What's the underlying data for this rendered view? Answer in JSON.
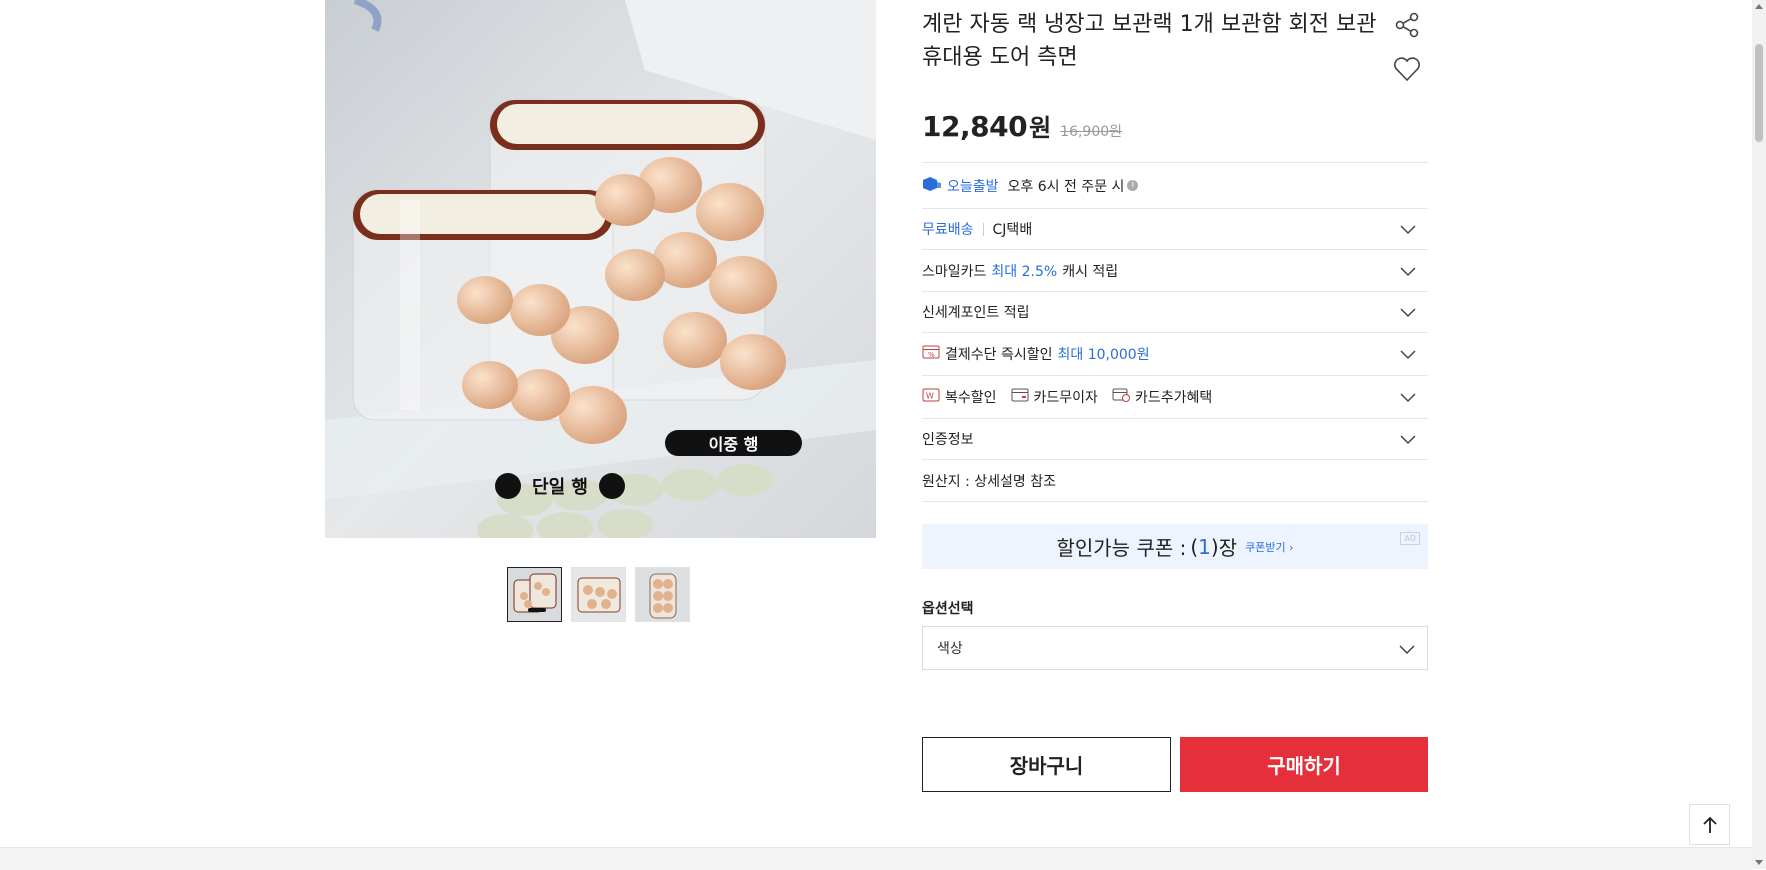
{
  "product": {
    "title": "계란 자동 랙 냉장고 보관랙 1개 보관함 회전 보관 휴대용 도어 측면",
    "price": "12,840",
    "currency": "원",
    "original_price": "16,900원",
    "image_overlay_labels": [
      "이중 행",
      "단일 행"
    ],
    "thumbnail_count": 3
  },
  "delivery": {
    "today_badge": "오늘출발",
    "today_text": "오후 6시 전 주문 시",
    "free_shipping": "무료배송",
    "courier": "CJ택배"
  },
  "benefits": {
    "smile_card_prefix": "스마일카드",
    "smile_card_highlight": "최대 2.5%",
    "smile_card_suffix": "캐시 적립",
    "shinsegae_point": "신세계포인트 적립",
    "payment_discount": "결제수단 즉시할인",
    "payment_discount_highlight": "최대 10,000원",
    "multi_discount": "복수할인",
    "card_interest_free": "카드무이자",
    "card_extra_benefit": "카드추가혜택",
    "certification": "인증정보",
    "origin": "원산지 : 상세설명 참조"
  },
  "coupon": {
    "label": "할인가능 쿠폰 :",
    "count_open": "(",
    "count": "1",
    "count_close": ")",
    "unit": "장",
    "receive": "쿠폰받기 ›",
    "ad_badge": "AD"
  },
  "options": {
    "label": "옵션선택",
    "select_placeholder": "색상"
  },
  "actions": {
    "cart": "장바구니",
    "buy": "구매하기"
  },
  "colors": {
    "accent_blue": "#2b6ed9",
    "buy_red": "#e5303b",
    "coupon_bg": "#eef4fd"
  },
  "icons": [
    "share-icon",
    "heart-icon",
    "chevron-down-icon",
    "arrow-up-icon",
    "info-icon",
    "truck-icon",
    "percent-card-icon",
    "discount-badge-icon",
    "card-icon",
    "card-gift-icon"
  ]
}
